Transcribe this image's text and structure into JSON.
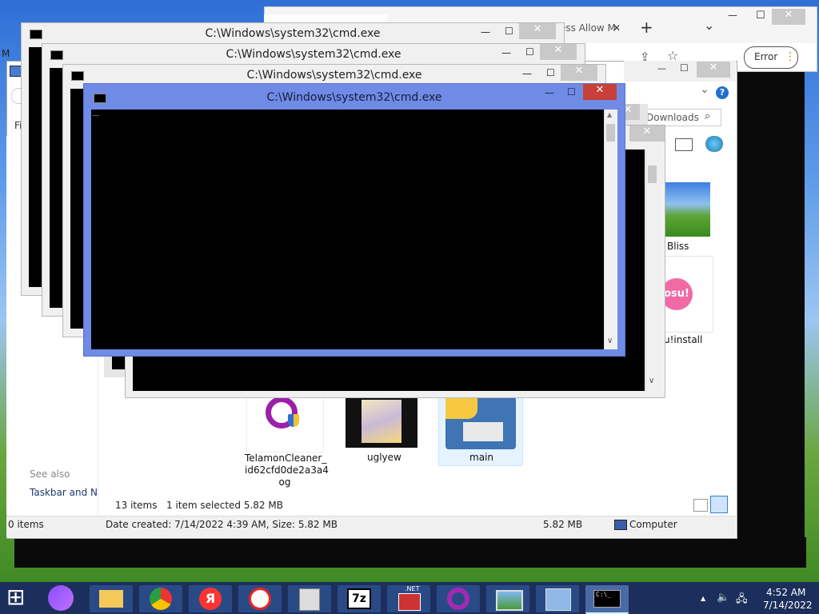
{
  "cmd_title": "C:\\Windows\\system32\\cmd.exe",
  "cursor": "_",
  "browser": {
    "tab_fragment": "ess Allow M",
    "error_label": "Error"
  },
  "explorer": {
    "search_text": "Downloads",
    "file_partial_left": "Fi",
    "left_header_partial": "M",
    "see_also": "See also",
    "taskbar_link": "Taskbar and Nav",
    "files": [
      {
        "label": "Bliss"
      },
      {
        "label": "u!install"
      },
      {
        "label": "TelamonCleaner_\nid62cfd0de2a3a4\nog"
      },
      {
        "label": "uglyew"
      },
      {
        "label": "main"
      }
    ],
    "osu_text": "osu!",
    "status_count": "13 items",
    "status_selected": "1 item selected  5.82 MB",
    "details": "Date created: 7/14/2022 4:39 AM, Size: 5.82 MB",
    "size": "5.82 MB",
    "location": "Computer",
    "left_status": "0 items"
  },
  "taskbar": {
    "time": "4:52 AM",
    "date": "7/14/2022",
    "yandex_label": "Я",
    "sevenzip_label": "7z",
    "net_label": ".NET",
    "cmd_icon_text": "C:\\_"
  },
  "glyphs": {
    "minimize": "—",
    "maximize": "☐",
    "close": "✕",
    "plus": "+",
    "chevron": "⌄",
    "search": "⌕",
    "help": "?",
    "scroll_up": "▲",
    "scroll_down": "∨",
    "kebab": "⋮",
    "share": "⇪",
    "star": "☆",
    "windows": "⊞",
    "tray_up": "▲",
    "speaker": "🔈",
    "network": "🖧"
  },
  "colors": {
    "active_title": "#6f8be6",
    "close_red": "#c7403a"
  }
}
